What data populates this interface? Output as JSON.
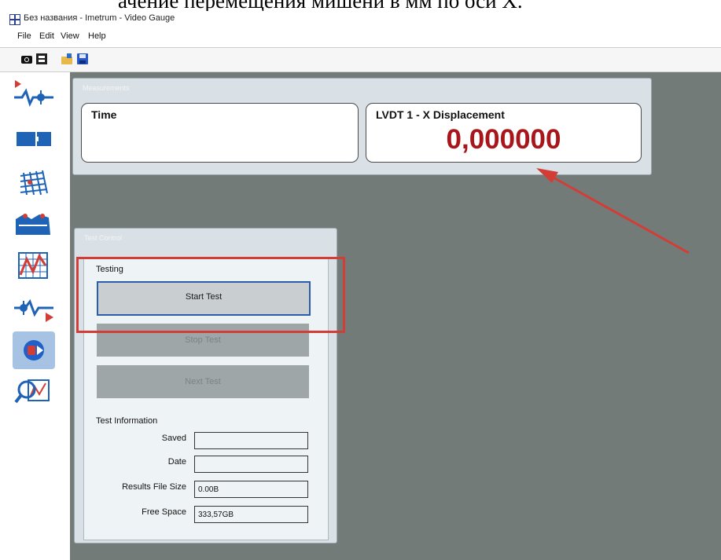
{
  "document_text": "ачение перемещения мишени в мм по оси X.",
  "window": {
    "title": "Без названия - Imetrum - Video Gauge"
  },
  "menu": {
    "items": [
      "File",
      "Edit",
      "View",
      "Help"
    ]
  },
  "toolbar": {
    "buttons": [
      "camera-icon",
      "film-icon",
      "open-icon",
      "save-icon"
    ]
  },
  "sidebar": {
    "buttons": [
      "targets-icon",
      "camera-view-icon",
      "grid-icon",
      "mesh-icon",
      "graph-icon",
      "signal-output-icon",
      "record-icon",
      "analysis-icon"
    ],
    "active": "record-icon"
  },
  "measurements": {
    "title": "Measurements",
    "time_label": "Time",
    "time_value": "",
    "lvdt_label": "LVDT 1 - X Displacement",
    "lvdt_value": "0,000000"
  },
  "test_control": {
    "title": "Test Control",
    "testing_label": "Testing",
    "start_button": "Start Test",
    "stop_button": "Stop Test",
    "next_button": "Next Test",
    "info_label": "Test Information",
    "saved_label": "Saved",
    "saved_value": "",
    "date_label": "Date",
    "date_value": "",
    "file_size_label": "Results File Size",
    "file_size_value": "0.00B",
    "free_space_label": "Free Space",
    "free_space_value": "333,57GB"
  },
  "annotation": {
    "color": "#d23d36"
  },
  "colors": {
    "value_red": "#a8161c",
    "workspace": "#737b79",
    "panel": "#d9e1e7"
  }
}
